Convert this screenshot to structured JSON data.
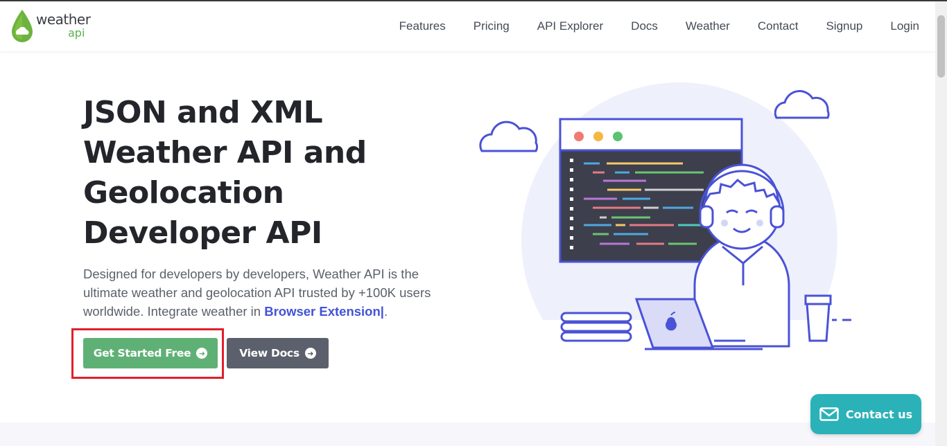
{
  "brand": {
    "logo_word": "weather",
    "logo_sub": "api"
  },
  "nav": {
    "items": [
      "Features",
      "Pricing",
      "API Explorer",
      "Docs",
      "Weather",
      "Contact",
      "Signup",
      "Login"
    ]
  },
  "hero": {
    "title": "JSON and XML Weather API and Geolocation Developer API",
    "description": "Designed for developers by developers, Weather API is the ultimate weather and geolocation API trusted by +100K users worldwide. Integrate weather in ",
    "highlight": "Browser Extension|",
    "description_end": ".",
    "primary_button": "Get Started Free",
    "secondary_button": "View Docs"
  },
  "contact": {
    "label": "Contact us"
  },
  "colors": {
    "brand_green": "#5fb075",
    "dark_button": "#5b606c",
    "accent_blue": "#4252d8",
    "contact_teal": "#2bb2b8",
    "highlight_red": "#e0202b"
  },
  "icons": {
    "logo": "drop-cloud-icon",
    "button_arrow": "arrow-circle-right-icon",
    "contact": "envelope-icon"
  }
}
